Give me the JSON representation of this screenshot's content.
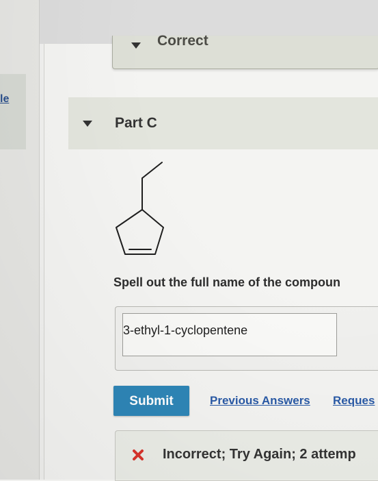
{
  "sidebar": {
    "link_fragment": "le"
  },
  "previous_part": {
    "status_label": "Correct"
  },
  "part": {
    "title": "Part C"
  },
  "question": {
    "prompt": "Spell out the full name of the compoun"
  },
  "answer": {
    "value": "3-ethyl-1-cyclopentene"
  },
  "actions": {
    "submit_label": "Submit",
    "previous_answers_label": "Previous Answers",
    "request_label": "Reques"
  },
  "feedback": {
    "text": "Incorrect; Try Again; 2 attemp"
  },
  "colors": {
    "submit_bg": "#2e86b7",
    "link": "#2a5aa6",
    "incorrect_x": "#d9332b"
  },
  "icons": {
    "collapse": "chevron-down-icon",
    "incorrect": "x-mark-icon",
    "structure": "molecule-icon"
  }
}
